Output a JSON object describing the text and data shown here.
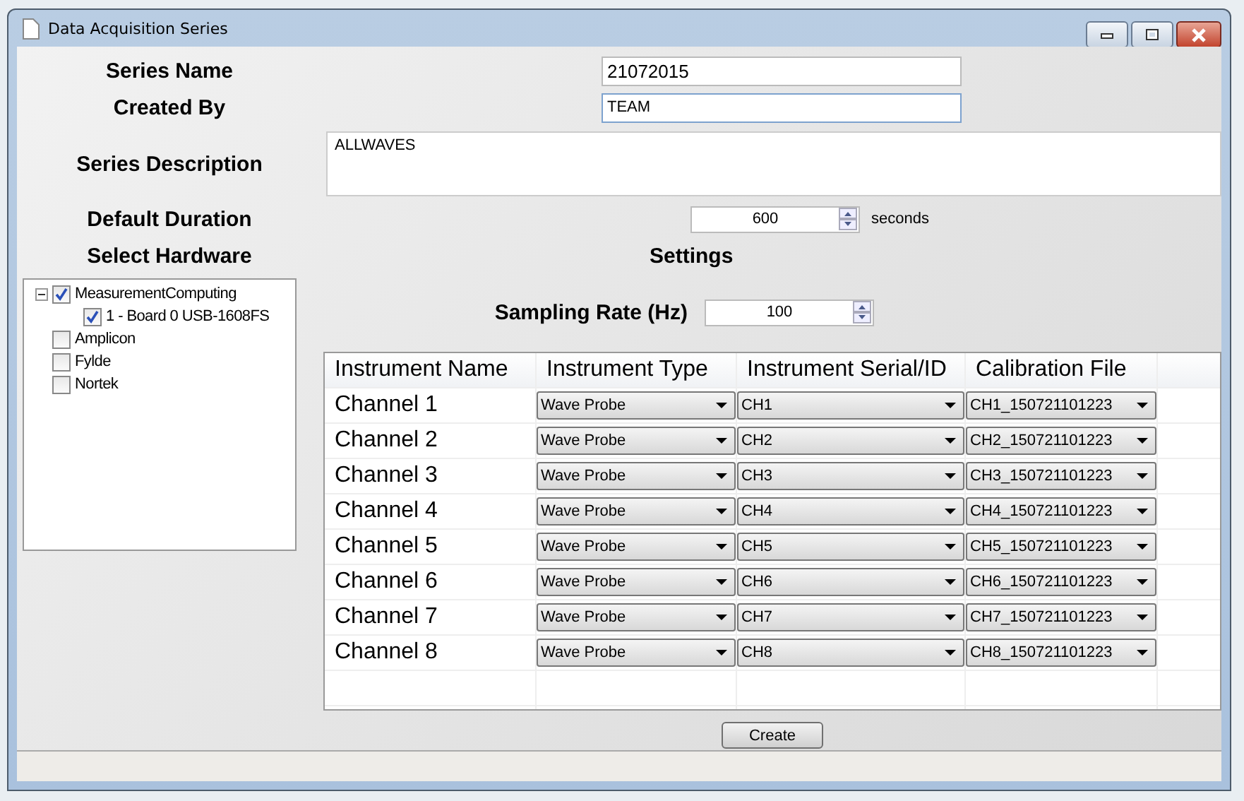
{
  "window": {
    "title": "Data Acquisition Series"
  },
  "fields": {
    "series_name": {
      "label": "Series Name",
      "value": "21072015"
    },
    "created_by": {
      "label": "Created By",
      "value": "TEAM"
    },
    "series_description": {
      "label": "Series Description",
      "value": "ALLWAVES"
    },
    "default_duration": {
      "label": "Default Duration",
      "value": "600",
      "unit": "seconds"
    }
  },
  "hardware": {
    "label": "Select Hardware",
    "tree": [
      {
        "label": "MeasurementComputing",
        "checked": true,
        "expanded": true,
        "children": [
          {
            "label": "1 - Board 0 USB-1608FS",
            "checked": true
          }
        ]
      },
      {
        "label": "Amplicon",
        "checked": false
      },
      {
        "label": "Fylde",
        "checked": false
      },
      {
        "label": "Nortek",
        "checked": false
      }
    ]
  },
  "settings": {
    "title": "Settings",
    "sampling_rate": {
      "label": "Sampling Rate (Hz)",
      "value": "100"
    }
  },
  "table": {
    "columns": [
      "Instrument Name",
      "Instrument Type",
      "Instrument Serial/ID",
      "Calibration File"
    ],
    "rows": [
      {
        "name": "Channel 1",
        "type": "Wave Probe",
        "serial": "CH1",
        "calibration": "CH1_150721101223"
      },
      {
        "name": "Channel 2",
        "type": "Wave Probe",
        "serial": "CH2",
        "calibration": "CH2_150721101223"
      },
      {
        "name": "Channel 3",
        "type": "Wave Probe",
        "serial": "CH3",
        "calibration": "CH3_150721101223"
      },
      {
        "name": "Channel 4",
        "type": "Wave Probe",
        "serial": "CH4",
        "calibration": "CH4_150721101223"
      },
      {
        "name": "Channel 5",
        "type": "Wave Probe",
        "serial": "CH5",
        "calibration": "CH5_150721101223"
      },
      {
        "name": "Channel 6",
        "type": "Wave Probe",
        "serial": "CH6",
        "calibration": "CH6_150721101223"
      },
      {
        "name": "Channel 7",
        "type": "Wave Probe",
        "serial": "CH7",
        "calibration": "CH7_150721101223"
      },
      {
        "name": "Channel 8",
        "type": "Wave Probe",
        "serial": "CH8",
        "calibration": "CH8_150721101223"
      }
    ]
  },
  "buttons": [
    "Create"
  ]
}
